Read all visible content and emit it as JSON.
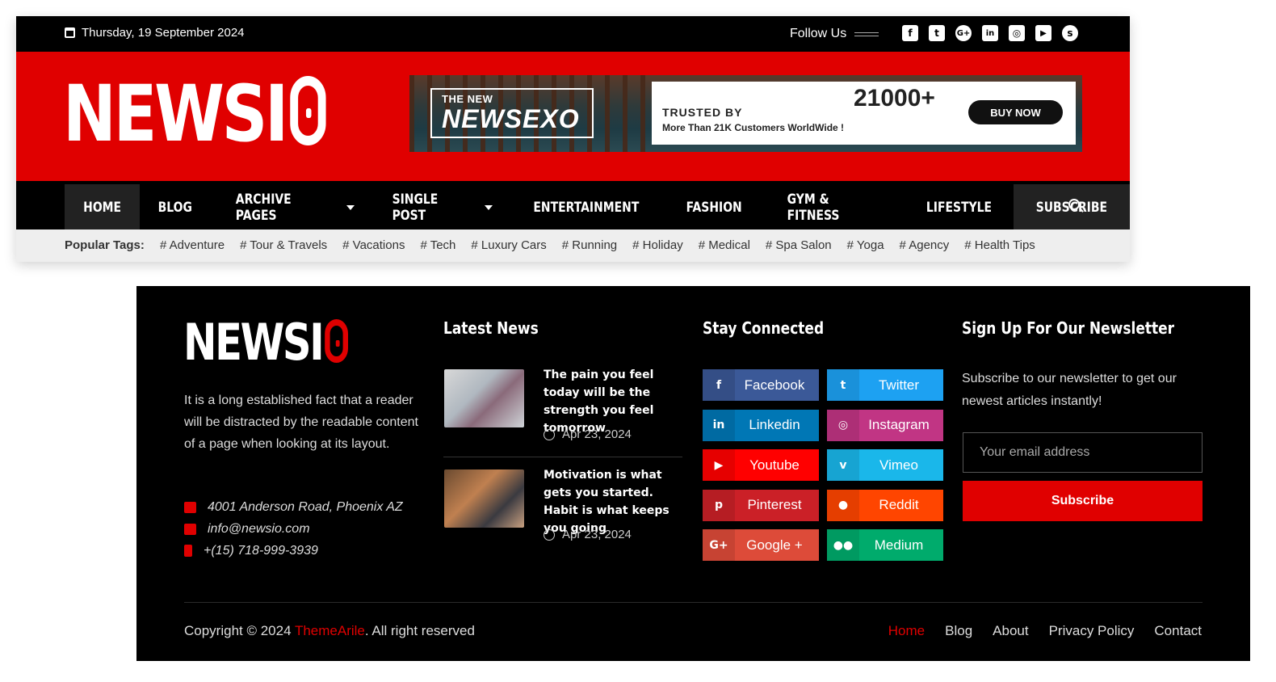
{
  "header": {
    "date": "Thursday, 19 September 2024",
    "follow_label": "Follow Us",
    "social_icons": [
      "facebook-icon",
      "twitter-icon",
      "google-plus-icon",
      "linkedin-icon",
      "instagram-icon",
      "youtube-icon",
      "skype-icon"
    ],
    "logo": "NEWSI",
    "ad": {
      "small": "THE NEW",
      "big": "NEWSEXO",
      "trusted": "TRUSTED BY",
      "more": "More Than 21K Customers WorldWide !",
      "count": "21000+",
      "cta": "BUY NOW"
    }
  },
  "nav": {
    "items": [
      {
        "label": "HOME",
        "active": true,
        "dropdown": false
      },
      {
        "label": "BLOG",
        "active": false,
        "dropdown": false
      },
      {
        "label": "ARCHIVE PAGES",
        "active": false,
        "dropdown": true
      },
      {
        "label": "SINGLE POST",
        "active": false,
        "dropdown": true
      },
      {
        "label": "ENTERTAINMENT",
        "active": false,
        "dropdown": false
      },
      {
        "label": "FASHION",
        "active": false,
        "dropdown": false
      },
      {
        "label": "GYM & FITNESS",
        "active": false,
        "dropdown": false
      },
      {
        "label": "LIFESTYLE",
        "active": false,
        "dropdown": false
      },
      {
        "label": "SUBSCRIBE",
        "active": true,
        "dropdown": false
      }
    ]
  },
  "tags": {
    "label": "Popular Tags:",
    "items": [
      "# Adventure",
      "# Tour & Travels",
      "# Vacations",
      "# Tech",
      "# Luxury Cars",
      "# Running",
      "# Holiday",
      "# Medical",
      "# Spa Salon",
      "# Yoga",
      "# Agency",
      "# Health Tips"
    ]
  },
  "footer": {
    "logo": "NEWSI",
    "about": "It is a long established fact that a reader will be distracted by the readable content of a page when looking at its layout.",
    "address": "4001 Anderson Road, Phoenix AZ",
    "email": "info@newsio.com",
    "phone": "+(15) 718-999-3939",
    "latest_title": "Latest News",
    "news": [
      {
        "title": "The pain you feel today will be the strength you feel tomorrow",
        "date": "Apr 23, 2024"
      },
      {
        "title": "Motivation is what gets you started. Habit is what keeps you going",
        "date": "Apr 23, 2024"
      }
    ],
    "connected_title": "Stay Connected",
    "social": [
      {
        "label": "Facebook",
        "icon": "f",
        "color": "#3b5998",
        "icon_bg": "#344e86"
      },
      {
        "label": "Twitter",
        "icon": "t",
        "color": "#1da1f2",
        "icon_bg": "#1a91da"
      },
      {
        "label": "Linkedin",
        "icon": "in",
        "color": "#0077b5",
        "icon_bg": "#006aa2"
      },
      {
        "label": "Instagram",
        "icon": "◎",
        "color": "#c13584",
        "icon_bg": "#ad2f76"
      },
      {
        "label": "Youtube",
        "icon": "▶",
        "color": "#ff0000",
        "icon_bg": "#e60000"
      },
      {
        "label": "Vimeo",
        "icon": "v",
        "color": "#1ab7ea",
        "icon_bg": "#17a4d2"
      },
      {
        "label": "Pinterest",
        "icon": "p",
        "color": "#cb2027",
        "icon_bg": "#b61d23"
      },
      {
        "label": "Reddit",
        "icon": "●",
        "color": "#ff4500",
        "icon_bg": "#e53e00"
      },
      {
        "label": "Google +",
        "icon": "G+",
        "color": "#dd4b39",
        "icon_bg": "#c74333"
      },
      {
        "label": "Medium",
        "icon": "●●",
        "color": "#00ab6c",
        "icon_bg": "#009a61"
      }
    ],
    "newsletter_title": "Sign Up For Our Newsletter",
    "newsletter_text": "Subscribe to our newsletter to get our newest articles instantly!",
    "email_placeholder": "Your email address",
    "subscribe_label": "Subscribe",
    "copyright_pre": "Copyright © 2024 ",
    "copyright_brand": "ThemeArile",
    "copyright_post": ". All right reserved",
    "links": [
      "Home",
      "Blog",
      "About",
      "Privacy Policy",
      "Contact"
    ]
  },
  "colors": {
    "accent": "#e00000",
    "dark": "#000000"
  }
}
